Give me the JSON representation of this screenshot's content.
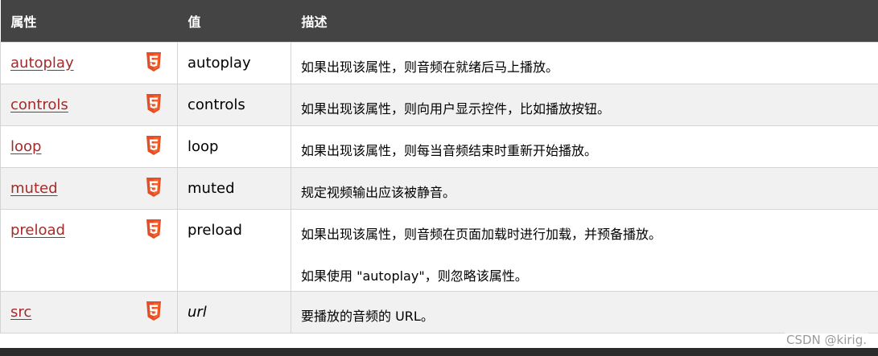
{
  "table": {
    "headers": {
      "attribute": "属性",
      "value": "值",
      "description": "描述"
    },
    "rows": [
      {
        "attr": "autoplay",
        "value": "autoplay",
        "desc": [
          "如果出现该属性，则音频在就绪后马上播放。"
        ]
      },
      {
        "attr": "controls",
        "value": "controls",
        "desc": [
          "如果出现该属性，则向用户显示控件，比如播放按钮。"
        ]
      },
      {
        "attr": "loop",
        "value": "loop",
        "desc": [
          "如果出现该属性，则每当音频结束时重新开始播放。"
        ]
      },
      {
        "attr": "muted",
        "value": "muted",
        "desc": [
          "规定视频输出应该被静音。"
        ]
      },
      {
        "attr": "preload",
        "value": "preload",
        "desc": [
          "如果出现该属性，则音频在页面加载时进行加载，并预备播放。",
          "如果使用 \"autoplay\"，则忽略该属性。"
        ]
      },
      {
        "attr": "src",
        "value": "url",
        "desc": [
          "要播放的音频的 URL。"
        ]
      }
    ]
  },
  "watermark": "CSDN @kirig.",
  "colors": {
    "header_bg": "#444444",
    "link": "#a52a2a",
    "html5_badge": "#e44d26",
    "row_alt": "#f1f1f1"
  },
  "icons": {
    "html5_badge": "html5-icon"
  }
}
